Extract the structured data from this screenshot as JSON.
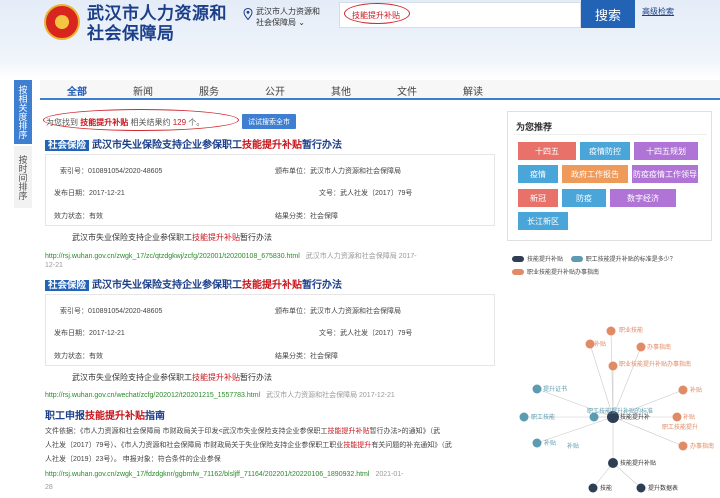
{
  "header": {
    "site_title_line1": "武汉市人力资源和",
    "site_title_line2": "社会保障局",
    "location_line1": "武汉市人力资源和",
    "location_line2": "社会保障局",
    "search_value": "技能提升补贴",
    "search_button": "搜索",
    "advanced_search": "高级检索"
  },
  "side_tabs": [
    "按相关度排序",
    "按时间排序"
  ],
  "nav_tabs": [
    "全部",
    "新闻",
    "服务",
    "公开",
    "其他",
    "文件",
    "解读"
  ],
  "result_info": {
    "prefix": "为您找到",
    "keyword": "技能提升补贴",
    "middle": "相关结果约",
    "count": "129",
    "suffix": "个。",
    "try_button": "试试搜索全市"
  },
  "results": [
    {
      "tag": "社会保险",
      "title_before": "武汉市失业保险支持企业参保职工",
      "title_highlight": "技能提升补贴",
      "title_after": "暂行办法",
      "index_no": "索引号：010891054/2020-48605",
      "publisher": "颁布单位：武汉市人力资源和社会保障局",
      "date": "发布日期：2017-12-21",
      "doc_no": "文号：武人社发〔2017〕79号",
      "validity": "效力状态：有效",
      "topic": "结果分类：社会保障",
      "snippet_before": "武汉市失业保险支持企业参保职工",
      "snippet_highlight": "技能提升补贴",
      "snippet_after": "暂行办法",
      "url": "http://rsj.wuhan.gov.cn/zwgk_17/zc/qtzdgkwj/zcfg/202001/t20200108_675830.html",
      "meta": "武汉市人力资源和社会保障局  2017-",
      "meta2": "12-21"
    },
    {
      "tag": "社会保险",
      "title_before": "武汉市失业保险支持企业参保职工",
      "title_highlight": "技能提升补贴",
      "title_after": "暂行办法",
      "index_no": "索引号：010891054/2020-48605",
      "publisher": "颁布单位：武汉市人力资源和社会保障局",
      "date": "发布日期：2017-12-21",
      "doc_no": "文号：武人社发〔2017〕79号",
      "validity": "效力状态：有效",
      "topic": "结果分类：社会保障",
      "snippet_before": "武汉市失业保险支持企业参保职工",
      "snippet_highlight": "技能提升补贴",
      "snippet_after": "暂行办法",
      "url": "http://rsj.wuhan.gov.cn/wechat/zcfg/202012/t20201215_1557783.html",
      "meta": "武汉市人力资源和社会保障局  2017-12-21"
    },
    {
      "title_before": "职工申报",
      "title_highlight": "技能提升补贴",
      "title_after": "指南",
      "doc_line1_before": "文件依据：《市人力资源和社会保障局 市财政局关于印发<武汉市失业保险支持企业参保职工",
      "doc_line1_hl": "技能提升补贴",
      "doc_line1_after": "暂行办法>的通知》（武",
      "doc_line2_before": "人社发〔2017〕79号）、《市人力资源和社会保障局 市财政局关于失业保险支持企业参保职工职业",
      "doc_line2_hl": "技能提升",
      "doc_line2_after": "有关问题的补充通知》（武",
      "doc_line3": "人社发〔2019〕23号）。      申报对象：符合条件的企业参保",
      "url": "http://rsj.wuhan.gov.cn/zwgk_17/fdzdgknr/ggbmfw_71162/blsljff_71164/202201/t20220106_1890932.html",
      "meta": "2021-01-",
      "meta2": "28"
    }
  ],
  "recommend": {
    "title": "为您推荐",
    "tags": [
      {
        "label": "十四五",
        "color": "#e8716a"
      },
      {
        "label": "疫情防控",
        "color": "#4aa5d9"
      },
      {
        "label": "十四五规划",
        "color": "#b074d6"
      },
      {
        "label": "疫情",
        "color": "#4aa5d9"
      },
      {
        "label": "政府工作报告",
        "color": "#ee9a5a"
      },
      {
        "label": "防疫疫情工作领导",
        "color": "#b074d6"
      },
      {
        "label": "新冠",
        "color": "#e8716a"
      },
      {
        "label": "防疫",
        "color": "#4aa5d9"
      },
      {
        "label": "数字经济",
        "color": "#b074d6"
      },
      {
        "label": "长江新区",
        "color": "#4aa5d9"
      }
    ]
  },
  "legend": [
    {
      "label": "技能提升补贴",
      "color": "#2e3e55"
    },
    {
      "label": "职工技能提升补贴的标准是多少？",
      "color": "#5d9cb0"
    },
    {
      "label": "职业技能提升补贴办事指南",
      "color": "#e08a66"
    }
  ],
  "graph": {
    "center": "技能提升补贴",
    "nodes": [
      "职业技能",
      "补贴",
      "办事指南",
      "职业技能提升补贴办事指南",
      "补贴",
      "提升证书",
      "职工技能",
      "职工技能提升补贴的标准",
      "技能提升补",
      "补贴",
      "补贴",
      "办事指南",
      "职工技能提升",
      "补贴",
      "技能提升补贴",
      "技能",
      "提升数据表"
    ]
  }
}
